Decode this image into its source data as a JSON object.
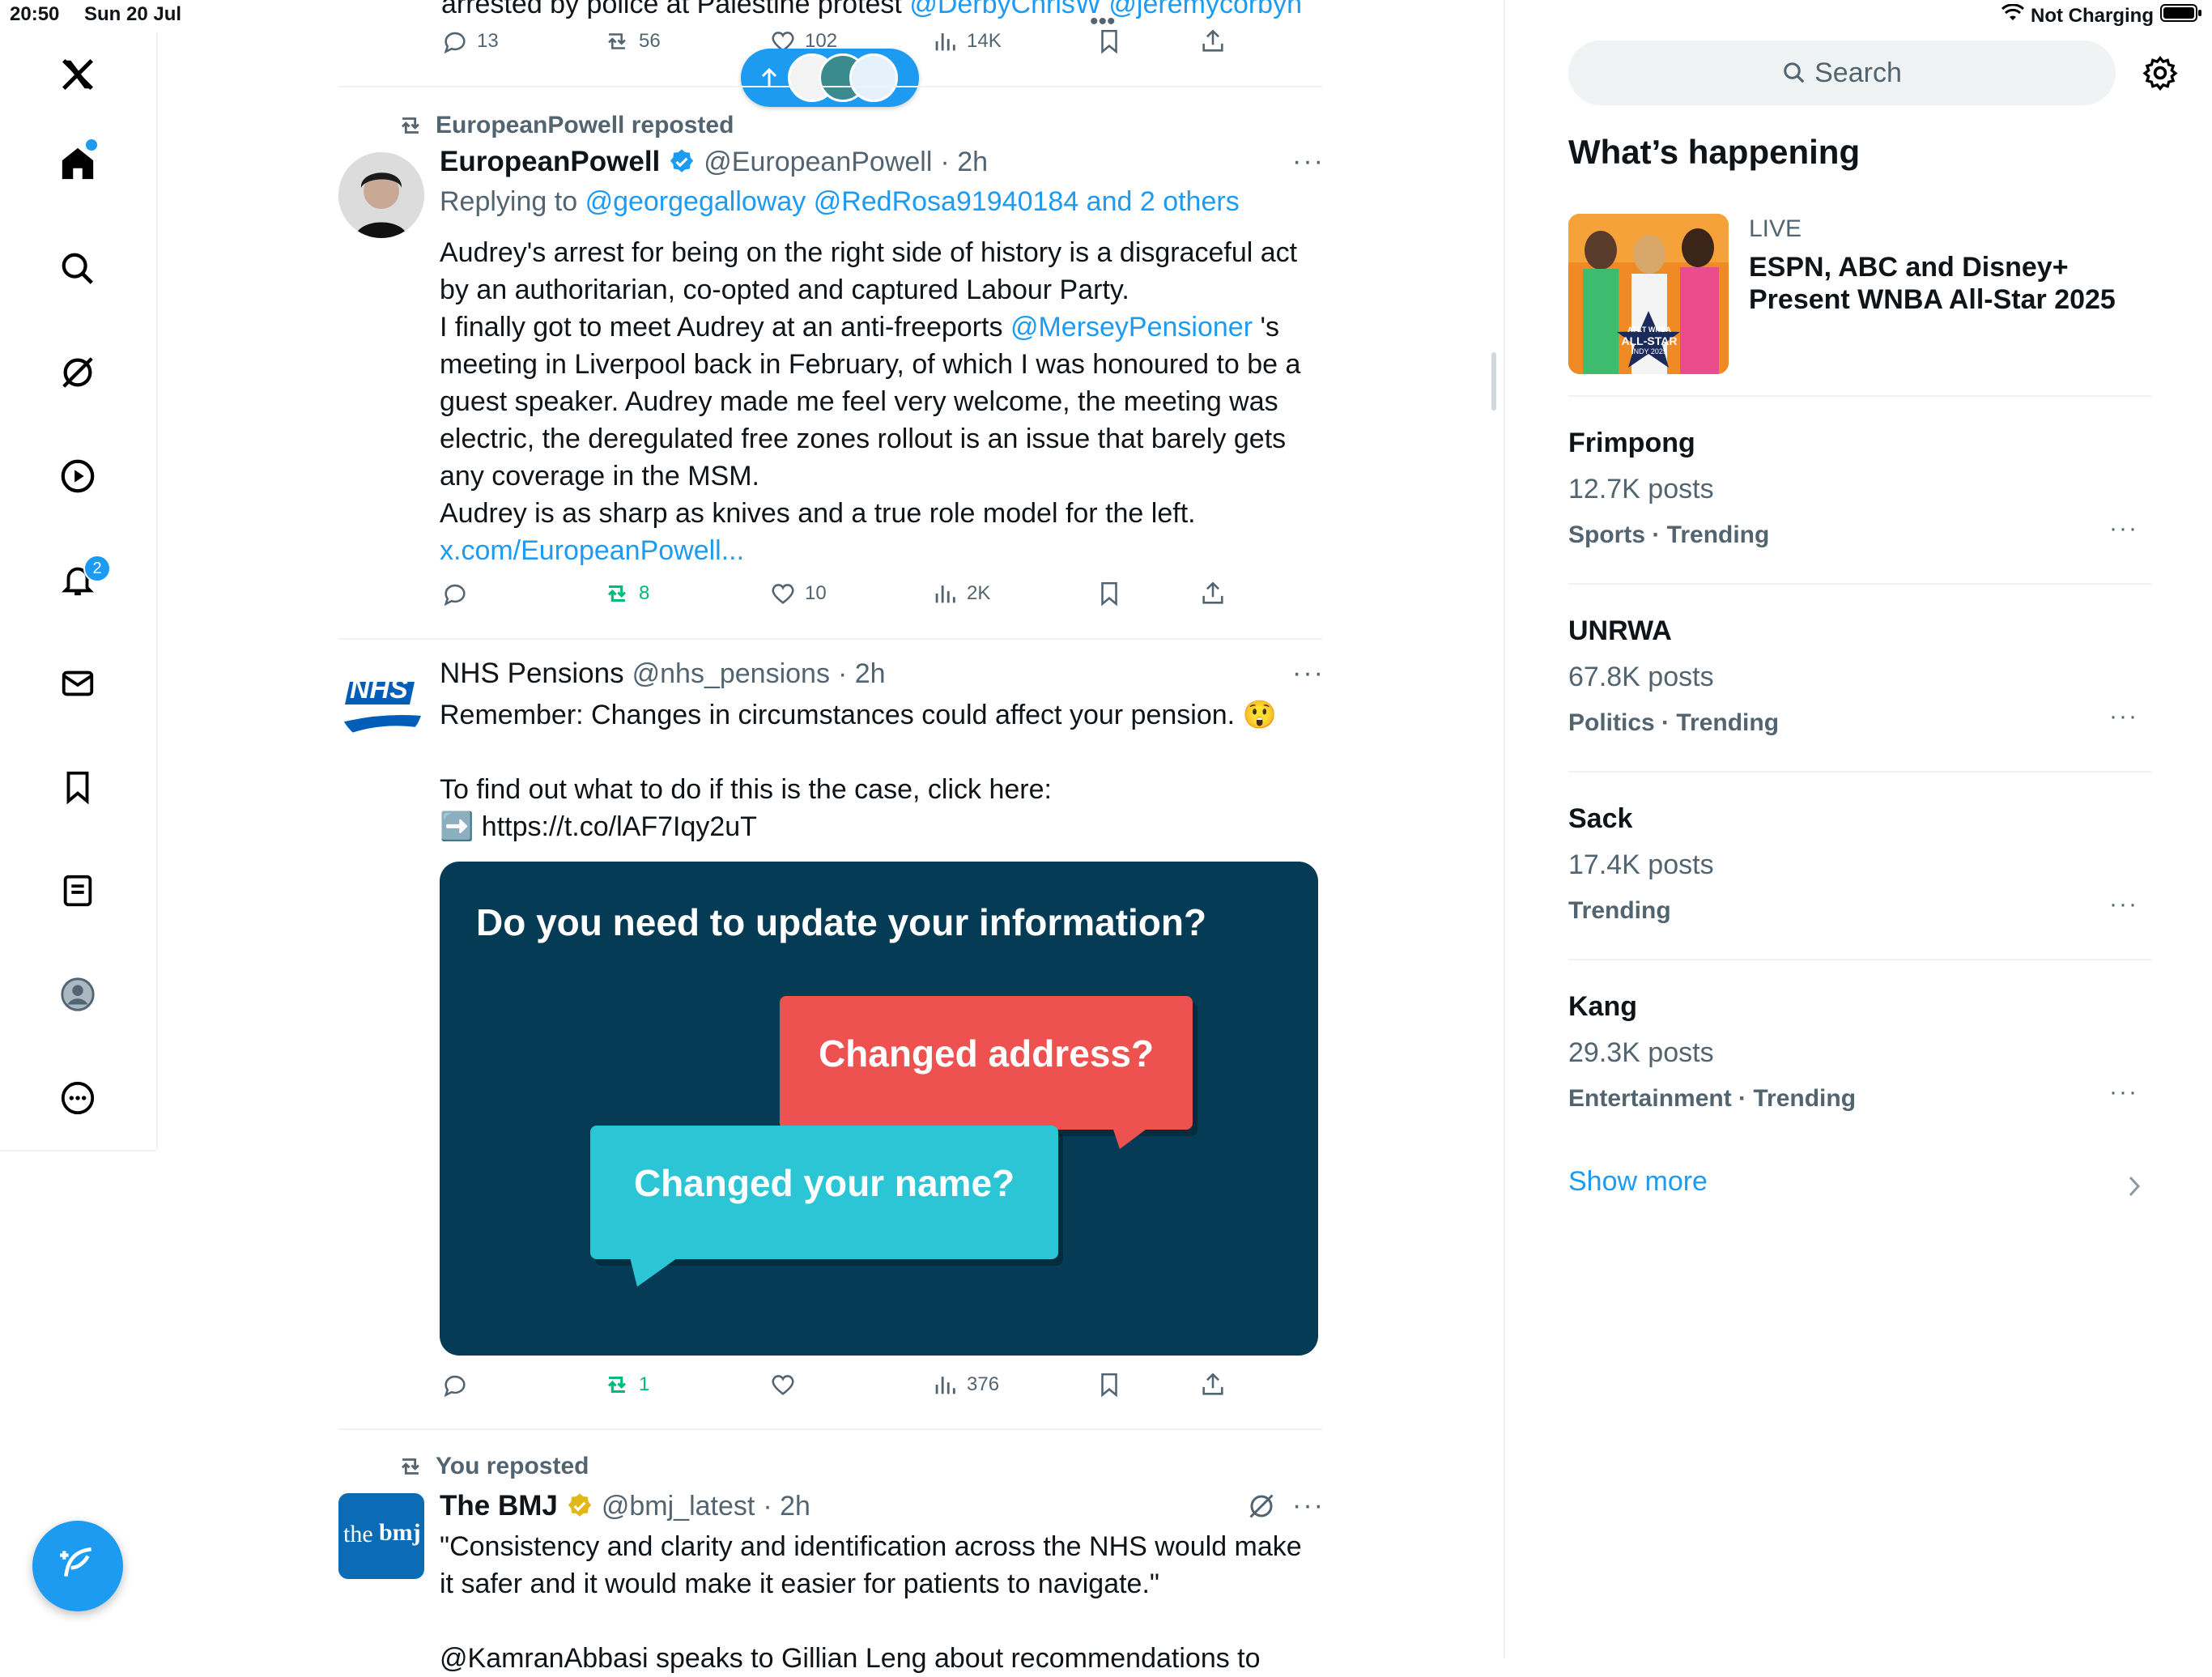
{
  "status_bar": {
    "time": "20:50",
    "date": "Sun 20 Jul",
    "connection": "Not Charging"
  },
  "nav": {
    "notifications_badge": "2"
  },
  "top_tweet": {
    "text_fragment": "arrested by police at Palestine protest",
    "mentions_fragment": "@DerbyChrisW @jeremycorbyn",
    "replies": "13",
    "reposts": "56",
    "likes": "102",
    "views": "14K"
  },
  "tweet1": {
    "repost_label": "EuropeanPowell reposted",
    "name": "EuropeanPowell",
    "handle": "@EuropeanPowell",
    "time": "· 2h",
    "replying_label": "Replying to",
    "replying_to": "@georgegalloway @RedRosa91940184 and 2 others",
    "line1": "Audrey's arrest for being on the right side of history is a disgraceful act",
    "line2": "by an authoritarian, co-opted and captured Labour Party.",
    "line3a": "I finally got to meet Audrey at an anti-freeports",
    "line3_mention": "@MerseyPensioner",
    "line3b": "'s",
    "line4": "meeting in Liverpool back in February, of which I was honoured to be a",
    "line5": "guest speaker. Audrey made me feel very welcome, the meeting was",
    "line6": "electric, the deregulated free zones rollout is an issue that barely gets",
    "line7": "any coverage in the MSM.",
    "line8": "Audrey is as sharp as knives and a true role model for the left.",
    "link": "x.com/EuropeanPowell...",
    "reposts": "8",
    "likes": "10",
    "views": "2K"
  },
  "tweet2": {
    "avatar_text": "NHS",
    "name": "NHS Pensions",
    "handle": "@nhs_pensions",
    "time": "· 2h",
    "line1": "Remember: Changes in circumstances could affect your pension. 😲",
    "line2": "To find out what to do if this is the case, click here:",
    "link_icon": "➡️",
    "link": "https://t.co/lAF7Iqy2uT",
    "card_title": "Do you need to update your information?",
    "bubble_red": "Changed address?",
    "bubble_teal": "Changed your name?",
    "reposts": "1",
    "views": "376"
  },
  "tweet3": {
    "repost_label": "You reposted",
    "avatar_text_a": "the",
    "avatar_text_b": "bmj",
    "name": "The BMJ",
    "handle": "@bmj_latest",
    "time": "· 2h",
    "line1": "\"Consistency and clarity and identification across the NHS would make",
    "line2": "it safer and it would make it easier for patients to navigate.\"",
    "line3": "@KamranAbbasi speaks to Gillian Leng about recommendations to"
  },
  "sidebar": {
    "search_placeholder": "Search",
    "heading": "What’s happening",
    "live_label": "LIVE",
    "live_title_1": "ESPN, ABC and Disney+",
    "live_title_2": "Present WNBA All-Star 2025",
    "live_image_text_1": "AT&T WNBA",
    "live_image_text_2": "ALL-STAR",
    "live_image_text_3": "INDY 2025",
    "trends": [
      {
        "title": "Frimpong",
        "count": "12.7K posts",
        "meta": "Sports · Trending"
      },
      {
        "title": "UNRWA",
        "count": "67.8K posts",
        "meta": "Politics · Trending"
      },
      {
        "title": "Sack",
        "count": "17.4K posts",
        "meta": "Trending"
      },
      {
        "title": "Kang",
        "count": "29.3K posts",
        "meta": "Entertainment · Trending"
      }
    ],
    "show_more": "Show more"
  },
  "colors": {
    "accent": "#1d9bf0",
    "repost_green": "#00ba7c",
    "card_bg": "#053b55",
    "bubble_red": "#ee5250",
    "bubble_teal": "#2bc5d6"
  }
}
